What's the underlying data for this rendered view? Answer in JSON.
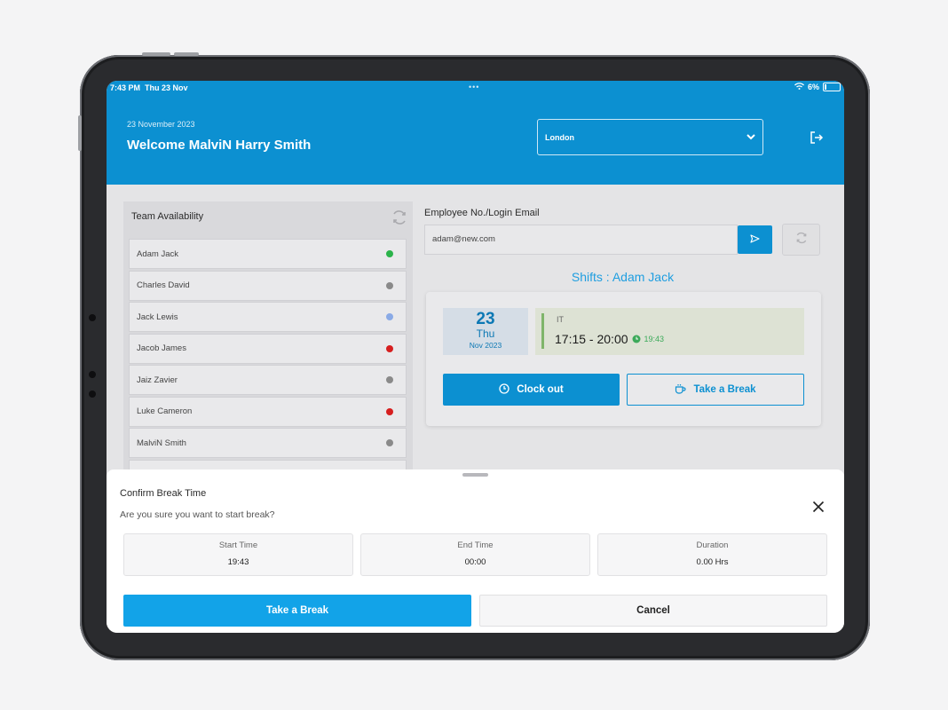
{
  "status_bar": {
    "time": "7:43 PM",
    "date": "Thu 23 Nov",
    "dots": "•••",
    "battery": "6%"
  },
  "header": {
    "date": "23 November 2023",
    "welcome": "Welcome MalviN Harry Smith",
    "location": "London"
  },
  "team": {
    "title": "Team Availability",
    "members": [
      {
        "name": "Adam Jack",
        "status_color": "#2bb34a"
      },
      {
        "name": "Charles David",
        "status_color": "#8a8a8a"
      },
      {
        "name": "Jack Lewis",
        "status_color": "#8aaae6"
      },
      {
        "name": "Jacob James",
        "status_color": "#d61f1f"
      },
      {
        "name": "Jaiz Zavier",
        "status_color": "#8a8a8a"
      },
      {
        "name": "Luke Cameron",
        "status_color": "#d61f1f"
      },
      {
        "name": "MalviN Smith",
        "status_color": "#8a8a8a"
      }
    ]
  },
  "employee": {
    "label": "Employee No./Login Email",
    "value": "adam@new.com"
  },
  "shift": {
    "title": "Shifts : Adam Jack",
    "day_num": "23",
    "day_name": "Thu",
    "month_year": "Nov 2023",
    "department": "IT",
    "hours": "17:15 - 20:00",
    "clock_in": "19:43",
    "clock_out_label": "Clock out",
    "take_break_label": "Take a Break"
  },
  "sheet": {
    "title": "Confirm Break Time",
    "subtitle": "Are you sure you want to start break?",
    "start_label": "Start Time",
    "start_value": "19:43",
    "end_label": "End Time",
    "end_value": "00:00",
    "duration_label": "Duration",
    "duration_value": "0.00 Hrs",
    "confirm_label": "Take a Break",
    "cancel_label": "Cancel"
  },
  "colors": {
    "primary": "#0c90d1",
    "confirm": "#12a3e8"
  }
}
